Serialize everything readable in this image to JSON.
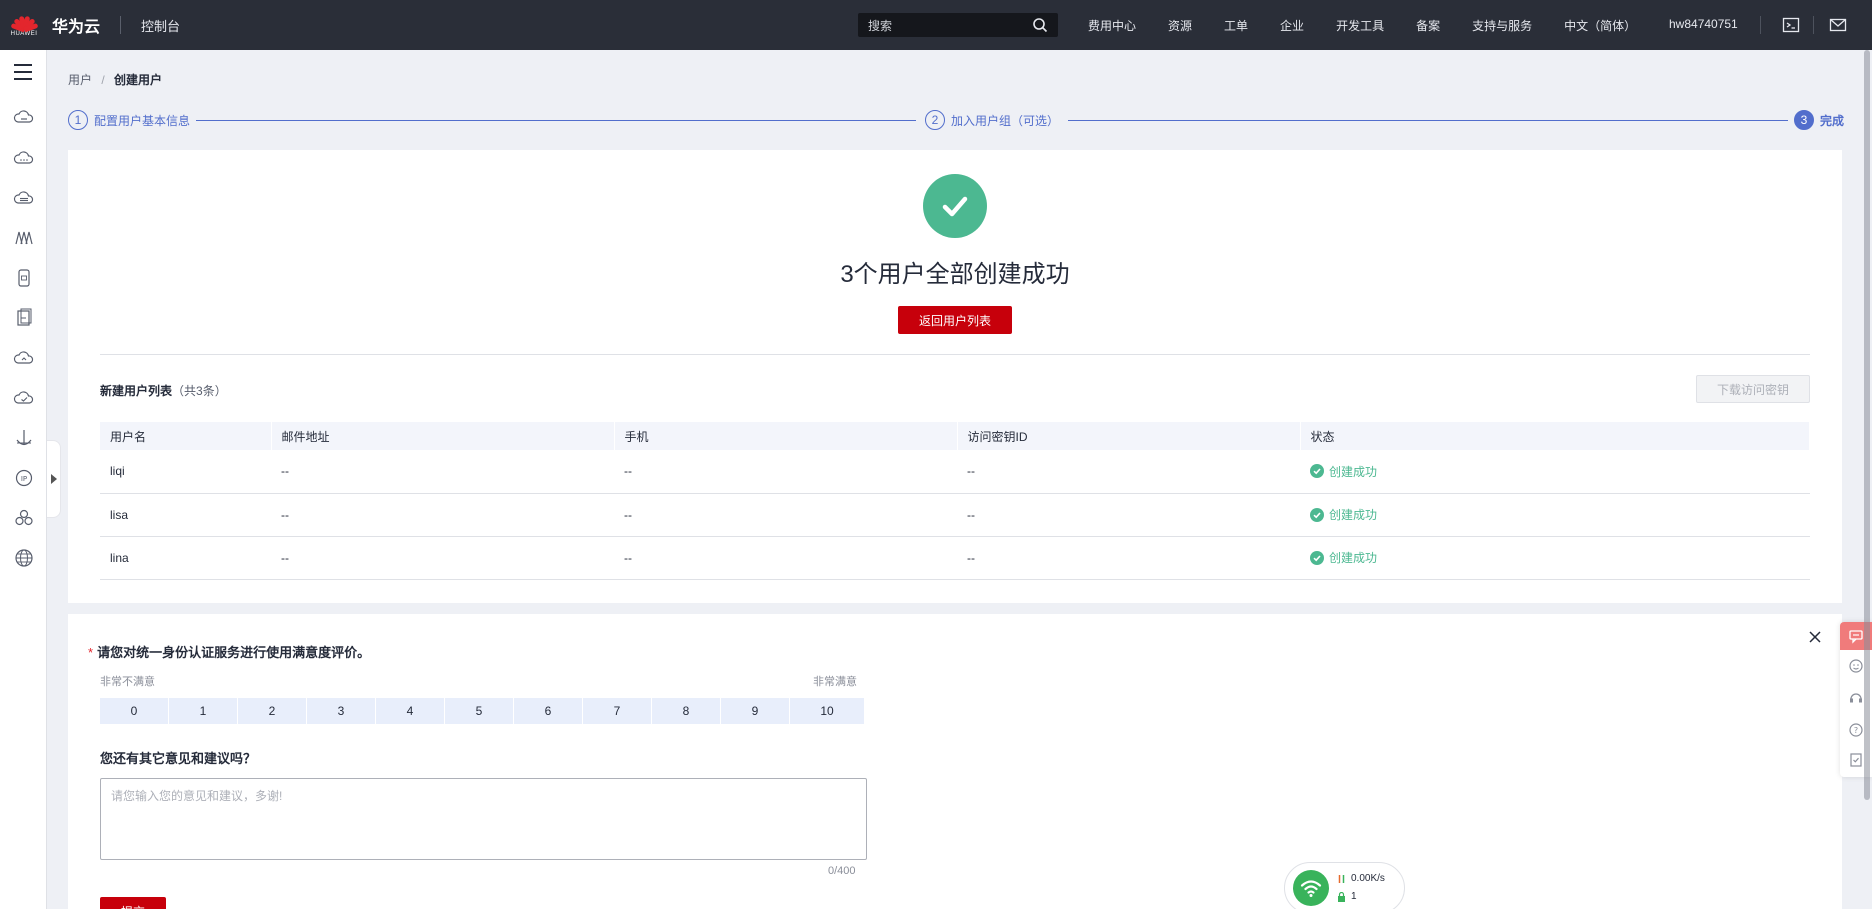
{
  "topbar": {
    "brand_small": "HUAWEI",
    "brand": "华为云",
    "console": "控制台",
    "search_placeholder": "搜索",
    "nav": [
      "费用中心",
      "资源",
      "工单",
      "企业",
      "开发工具",
      "备案",
      "支持与服务",
      "中文（简体）"
    ],
    "username": "hw84740751"
  },
  "breadcrumb": {
    "parent": "用户",
    "separator": "/",
    "current": "创建用户"
  },
  "steps": [
    {
      "num": "1",
      "label": "配置用户基本信息"
    },
    {
      "num": "2",
      "label": "加入用户组（可选）"
    },
    {
      "num": "3",
      "label": "完成"
    }
  ],
  "result": {
    "title": "3个用户全部创建成功",
    "back_button": "返回用户列表",
    "list_title": "新建用户列表",
    "list_count": "（共3条）",
    "download_button": "下载访问密钥"
  },
  "table": {
    "columns": [
      "用户名",
      "邮件地址",
      "手机",
      "访问密钥ID",
      "状态"
    ],
    "rows": [
      {
        "name": "liqi",
        "email": "--",
        "phone": "--",
        "key": "--",
        "status": "创建成功"
      },
      {
        "name": "lisa",
        "email": "--",
        "phone": "--",
        "key": "--",
        "status": "创建成功"
      },
      {
        "name": "lina",
        "email": "--",
        "phone": "--",
        "key": "--",
        "status": "创建成功"
      }
    ]
  },
  "survey": {
    "required_mark": "*",
    "question1": "请您对统一身份认证服务进行使用满意度评价。",
    "low_label": "非常不满意",
    "high_label": "非常满意",
    "scale": [
      "0",
      "1",
      "2",
      "3",
      "4",
      "5",
      "6",
      "7",
      "8",
      "9",
      "10"
    ],
    "question2": "您还有其它意见和建议吗？",
    "placeholder": "请您输入您的意见和建议，多谢!",
    "char_count": "0/400",
    "submit": "提交"
  },
  "network": {
    "speed": "0.00K/s",
    "count": "1"
  },
  "colors": {
    "brand_red": "#c7000b",
    "accent_blue": "#526ecc",
    "success_green": "#4cb891",
    "topbar": "#2a2e38"
  }
}
